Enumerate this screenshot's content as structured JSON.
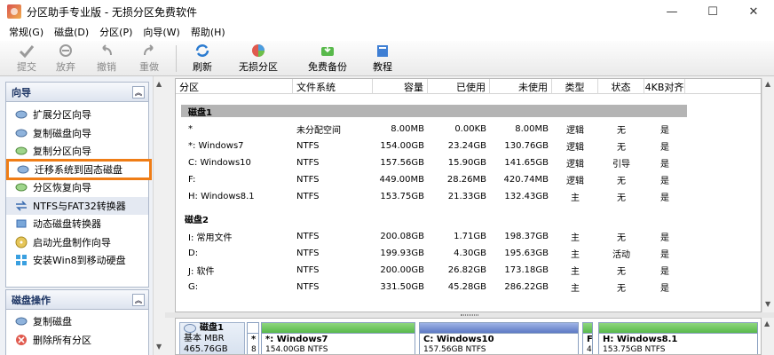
{
  "window": {
    "title": "分区助手专业版 - 无损分区免费软件",
    "min": "—",
    "max": "☐",
    "close": "✕"
  },
  "menu": [
    "常规(G)",
    "磁盘(D)",
    "分区(P)",
    "向导(W)",
    "帮助(H)"
  ],
  "toolbar": {
    "submit": "提交",
    "discard": "放弃",
    "undo": "撤销",
    "redo": "重做",
    "refresh": "刷新",
    "lossless": "无损分区",
    "backup": "免费备份",
    "tutorial": "教程"
  },
  "wizard": {
    "title": "向导",
    "items": [
      "扩展分区向导",
      "复制磁盘向导",
      "复制分区向导",
      "迁移系统到固态磁盘",
      "分区恢复向导",
      "NTFS与FAT32转换器",
      "动态磁盘转换器",
      "启动光盘制作向导",
      "安装Win8到移动硬盘"
    ]
  },
  "disk_ops": {
    "title": "磁盘操作",
    "items": [
      "复制磁盘",
      "删除所有分区"
    ]
  },
  "columns": [
    "分区",
    "文件系统",
    "容量",
    "已使用",
    "未使用",
    "类型",
    "状态",
    "4KB对齐"
  ],
  "disk1": {
    "label": "磁盘1",
    "rows": [
      [
        "*",
        "未分配空间",
        "8.00MB",
        "0.00KB",
        "8.00MB",
        "逻辑",
        "无",
        "是"
      ],
      [
        "*: Windows7",
        "NTFS",
        "154.00GB",
        "23.24GB",
        "130.76GB",
        "逻辑",
        "无",
        "是"
      ],
      [
        "C: Windows10",
        "NTFS",
        "157.56GB",
        "15.90GB",
        "141.65GB",
        "逻辑",
        "引导",
        "是"
      ],
      [
        "F:",
        "NTFS",
        "449.00MB",
        "28.26MB",
        "420.74MB",
        "逻辑",
        "无",
        "是"
      ],
      [
        "H: Windows8.1",
        "NTFS",
        "153.75GB",
        "21.33GB",
        "132.43GB",
        "主",
        "无",
        "是"
      ]
    ]
  },
  "disk2": {
    "label": "磁盘2",
    "rows": [
      [
        "I: 常用文件",
        "NTFS",
        "200.08GB",
        "1.71GB",
        "198.37GB",
        "主",
        "无",
        "是"
      ],
      [
        "D:",
        "NTFS",
        "199.93GB",
        "4.30GB",
        "195.63GB",
        "主",
        "活动",
        "是"
      ],
      [
        "J: 软件",
        "NTFS",
        "200.00GB",
        "26.82GB",
        "173.18GB",
        "主",
        "无",
        "是"
      ],
      [
        "G:",
        "NTFS",
        "331.50GB",
        "45.28GB",
        "286.22GB",
        "主",
        "无",
        "是"
      ]
    ]
  },
  "diskmap": {
    "disk_name": "磁盘1",
    "disk_type": "基本 MBR",
    "disk_size": "465.76GB",
    "parts": [
      {
        "label": "*",
        "sub": "8"
      },
      {
        "label": "*: Windows7",
        "sub": "154.00GB NTFS"
      },
      {
        "label": "C: Windows10",
        "sub": "157.56GB NTFS"
      },
      {
        "label": "F",
        "sub": "4"
      },
      {
        "label": "H: Windows8.1",
        "sub": "153.75GB NTFS"
      }
    ]
  },
  "colors": {
    "accent": "#ef7d16",
    "used_bar": "#58b94b",
    "used_bar2": "#5d79c4",
    "disk_band": "#b4b4b4"
  }
}
